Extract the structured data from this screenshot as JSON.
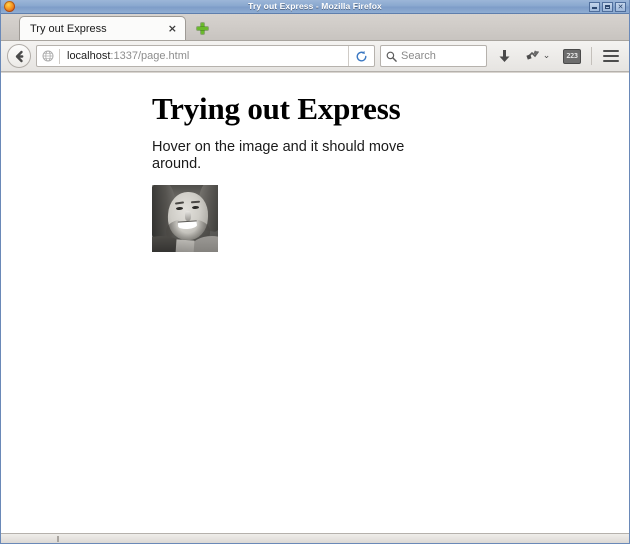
{
  "window": {
    "title": "Try out Express - Mozilla Firefox",
    "app_icon": "firefox-logo-icon",
    "controls": {
      "minimize_label": "Minimize",
      "maximize_label": "Maximize",
      "close_label": "Close"
    }
  },
  "tabstrip": {
    "tabs": [
      {
        "title": "Try out Express",
        "close_label": "×",
        "active": true
      }
    ],
    "new_tab_label": "+"
  },
  "navbar": {
    "back_label": "Back",
    "identity_icon": "globe-icon",
    "url": {
      "host": "localhost",
      "path": ":1337/page.html",
      "full": "localhost:1337/page.html"
    },
    "reload_label": "Reload",
    "search": {
      "placeholder": "Search",
      "icon": "search-icon"
    },
    "buttons": [
      {
        "name": "downloads-button",
        "icon": "download-arrow-icon"
      },
      {
        "name": "plugin-button",
        "icon": "plugin-icon",
        "chevron": "⌄"
      },
      {
        "name": "devtools-button",
        "icon": "devtools-icon",
        "glyph": "223"
      },
      {
        "name": "menu-button",
        "icon": "hamburger-menu-icon"
      }
    ]
  },
  "page": {
    "heading": "Trying out Express",
    "paragraph": "Hover on the image and it should move around.",
    "image_alt": "Grayscale portrait photo of a smiling man"
  },
  "colors": {
    "titlebar_blue": "#8aa8cf",
    "toolbar_gray": "#eeecea",
    "tab_active": "#fbfbfa",
    "newtab_green": "#6aba2c",
    "content_bg": "#ffffff",
    "text": "#1a1a1a",
    "url_dim": "#8d8d8d"
  }
}
